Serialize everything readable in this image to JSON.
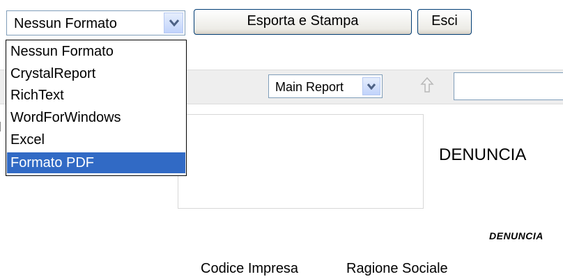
{
  "format_select": {
    "selected": "Nessun Formato",
    "options": [
      "Nessun Formato",
      "CrystalReport",
      "RichText",
      "WordForWindows",
      "Excel",
      "Formato PDF"
    ],
    "highlighted": "Formato PDF"
  },
  "buttons": {
    "export_print": "Esporta e Stampa",
    "exit": "Esci"
  },
  "toolbar": {
    "report_select": "Main Report",
    "search_value": ""
  },
  "report": {
    "title": "DENUNCIA",
    "subtitle": "DENUNCIA",
    "columns": [
      "Codice Impresa",
      "Ragione Sociale"
    ]
  },
  "colors": {
    "highlight": "#316ac5",
    "toolbar_bg": "#eeeeee"
  }
}
